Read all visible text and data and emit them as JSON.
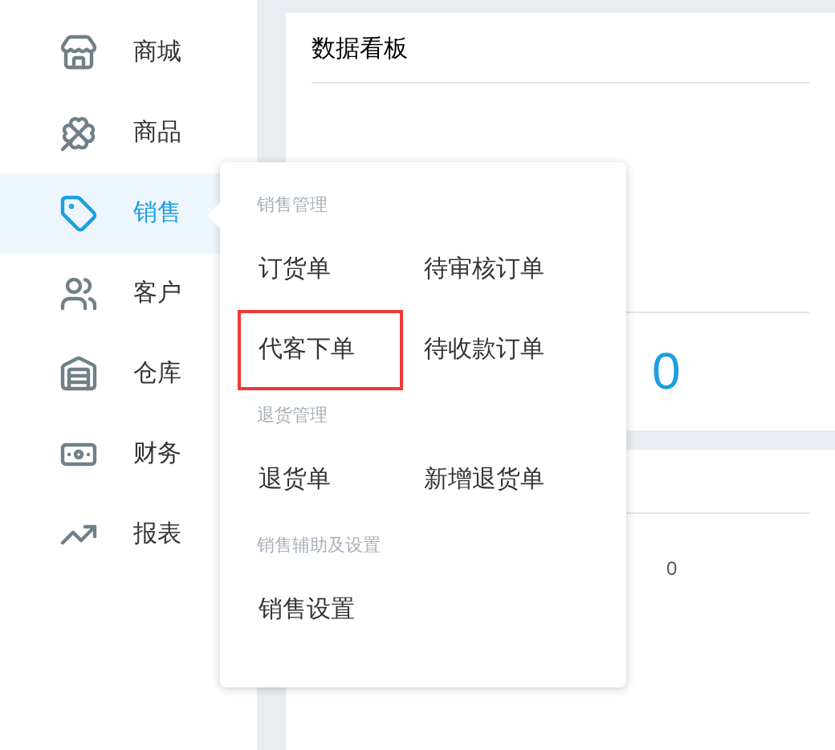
{
  "sidebar": {
    "items": [
      {
        "label": "商城",
        "selected": false
      },
      {
        "label": "商品",
        "selected": false
      },
      {
        "label": "销售",
        "selected": true
      },
      {
        "label": "客户",
        "selected": false
      },
      {
        "label": "仓库",
        "selected": false
      },
      {
        "label": "财务",
        "selected": false
      },
      {
        "label": "报表",
        "selected": false
      }
    ]
  },
  "dashboard": {
    "title": "数据看板",
    "value_2": "0",
    "value_3": "0"
  },
  "flyout": {
    "sections": [
      {
        "title": "销售管理",
        "items": [
          {
            "label": "订货单",
            "highlighted": false
          },
          {
            "label": "待审核订单",
            "highlighted": false
          },
          {
            "label": "代客下单",
            "highlighted": true
          },
          {
            "label": "待收款订单",
            "highlighted": false
          }
        ]
      },
      {
        "title": "退货管理",
        "items": [
          {
            "label": "退货单",
            "highlighted": false
          },
          {
            "label": "新增退货单",
            "highlighted": false
          }
        ]
      },
      {
        "title": "销售辅助及设置",
        "items": [
          {
            "label": "销售设置",
            "highlighted": false
          }
        ]
      }
    ]
  }
}
